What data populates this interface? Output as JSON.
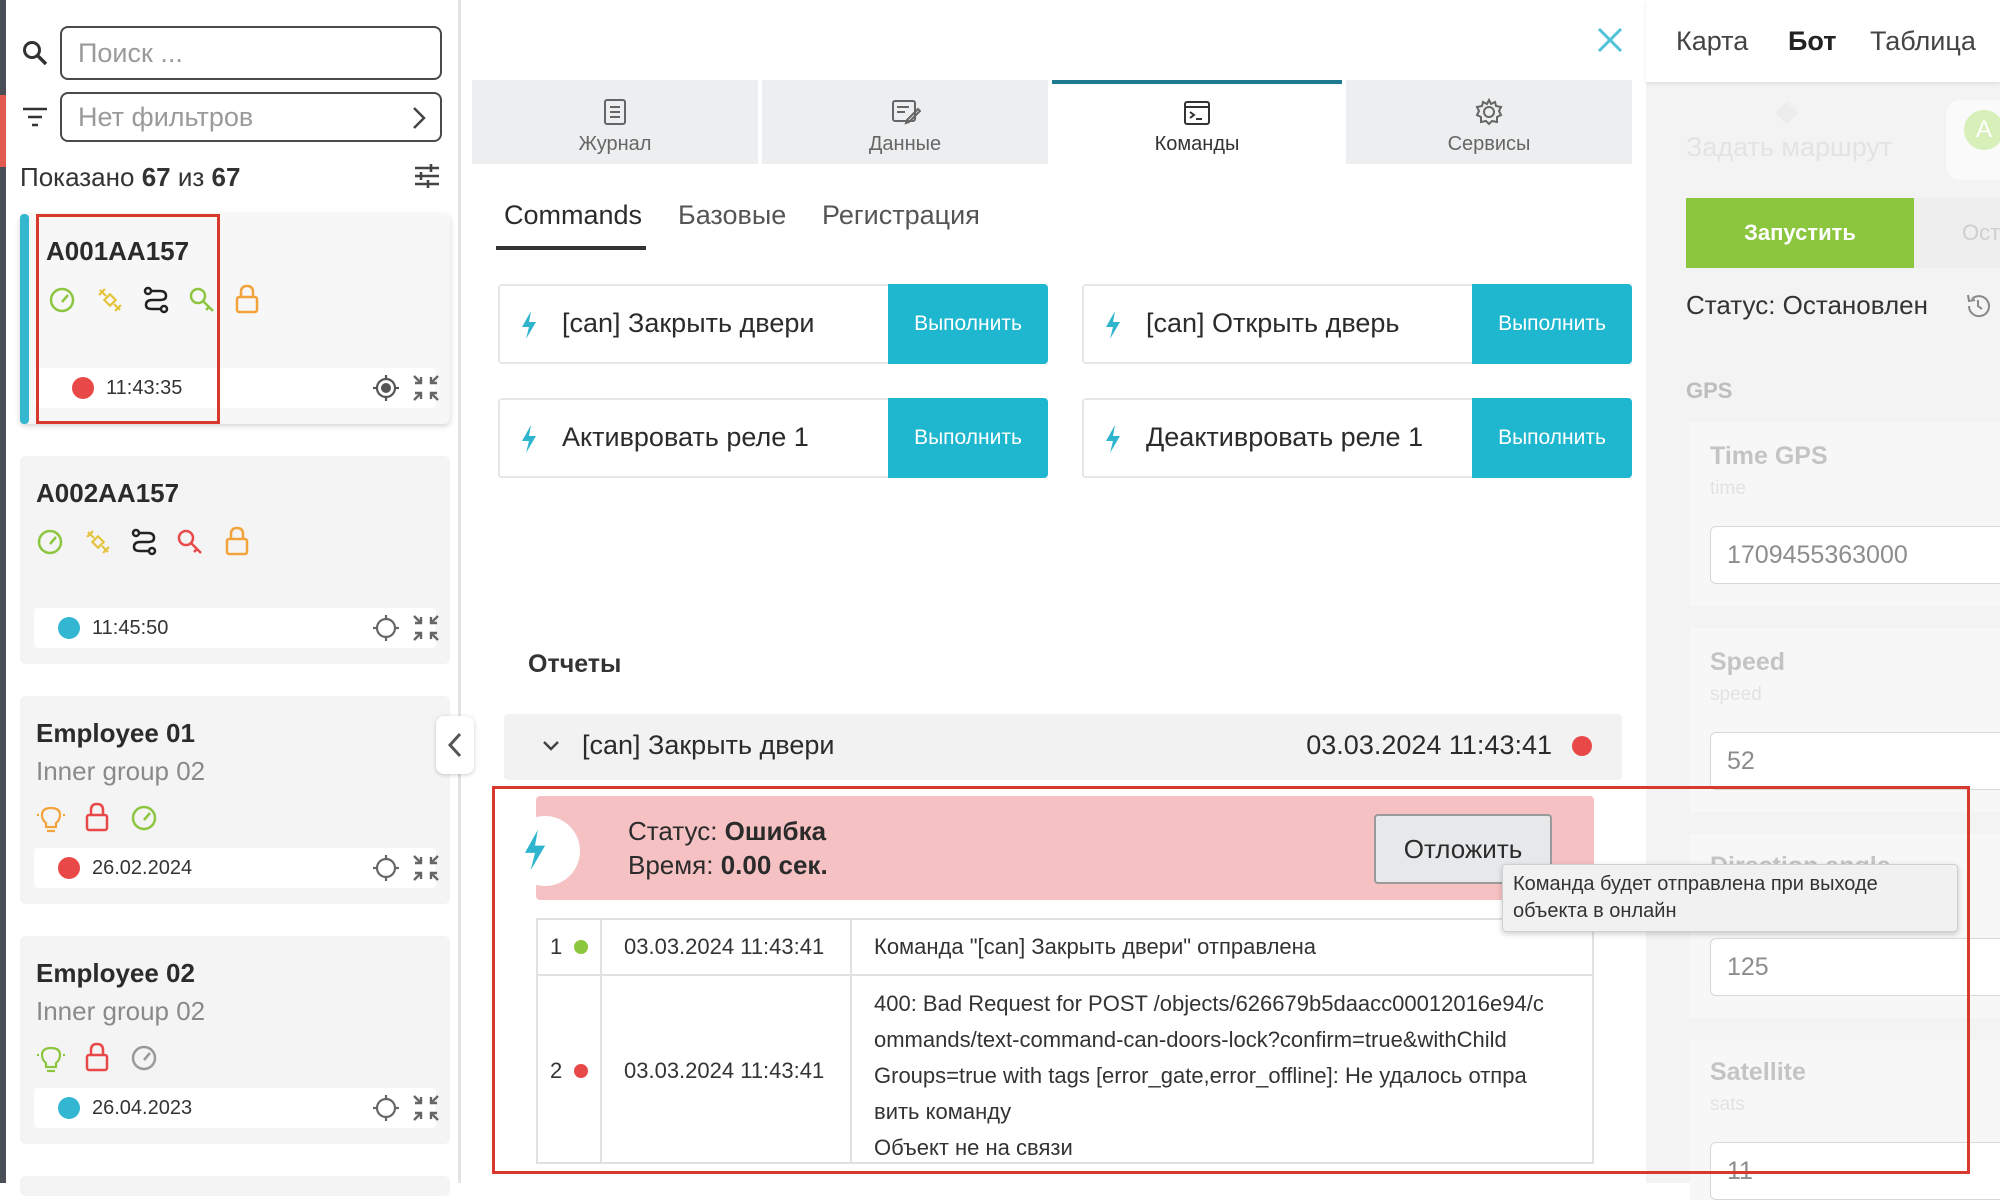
{
  "search": {
    "placeholder": "Поиск ..."
  },
  "filter": {
    "value": "Нет фильтров"
  },
  "shown": {
    "prefix": "Показано",
    "count": "67",
    "sep": "из",
    "total": "67"
  },
  "objects": [
    {
      "title": "A001AA157",
      "subtitle": "",
      "time": "11:43:35",
      "status_color": "#e84848"
    },
    {
      "title": "A002AA157",
      "subtitle": "",
      "time": "11:45:50",
      "status_color": "#33b6d1"
    },
    {
      "title": "Employee 01",
      "subtitle": "Inner group 02",
      "time": "26.02.2024",
      "status_color": "#e84848"
    },
    {
      "title": "Employee 02",
      "subtitle": "Inner group 02",
      "time": "26.04.2023",
      "status_color": "#33b6d1"
    }
  ],
  "main_tabs": [
    {
      "label": "Журнал",
      "icon": "journal-icon"
    },
    {
      "label": "Данные",
      "icon": "data-icon"
    },
    {
      "label": "Команды",
      "icon": "terminal-icon"
    },
    {
      "label": "Сервисы",
      "icon": "gear-icon"
    }
  ],
  "sub_tabs": [
    {
      "label": "Commands"
    },
    {
      "label": "Базовые"
    },
    {
      "label": "Регистрация"
    }
  ],
  "commands": [
    {
      "name": "[can] Закрыть двери",
      "action": "Выполнить"
    },
    {
      "name": "[can] Открыть дверь",
      "action": "Выполнить"
    },
    {
      "name": "Активровать реле 1",
      "action": "Выполнить"
    },
    {
      "name": "Деактивровать реле 1",
      "action": "Выполнить"
    }
  ],
  "reports": {
    "title": "Отчеты",
    "item": {
      "name": "[can] Закрыть двери",
      "datetime": "03.03.2024 11:43:41",
      "status_color": "#e84848"
    },
    "status_label": "Статус:",
    "status_value": "Ошибка",
    "time_label": "Время:",
    "time_value": "0.00 сек.",
    "postpone": "Отложить",
    "tooltip_line1": "Команда будет отправлена при выходе",
    "tooltip_line2": "объекта в онлайн",
    "log": [
      {
        "n": "1",
        "color": "#8cc63f",
        "datetime": "03.03.2024 11:43:41",
        "lines": [
          "Команда \"[can] Закрыть двери\" отправлена"
        ]
      },
      {
        "n": "2",
        "color": "#e84848",
        "datetime": "03.03.2024 11:43:41",
        "lines": [
          "400: Bad Request for POST /objects/626679b5daacc00012016e94/c",
          "ommands/text-command-can-doors-lock?confirm=true&withChild",
          "Groups=true with tags [error_gate,error_offline]: Не удалось отпра",
          "вить команду",
          "Объект не на связи"
        ]
      }
    ]
  },
  "right": {
    "tabs": [
      "Карта",
      "Бот",
      "Таблица"
    ],
    "route": "Задать маршрут",
    "avatar": "A",
    "start": "Запустить",
    "stop": "Ост",
    "status": "Статус: Остановлен",
    "gps": "GPS",
    "fields": [
      {
        "label": "Time GPS",
        "sub": "time",
        "value": "1709455363000"
      },
      {
        "label": "Speed",
        "sub": "speed",
        "value": "52"
      },
      {
        "label": "Direction angle",
        "sub": "",
        "value": "125"
      },
      {
        "label": "Satellite",
        "sub": "sats",
        "value": "11"
      }
    ]
  },
  "colors": {
    "accent": "#1fb7cf",
    "green": "#8cc63f",
    "error_bg": "#f5c1c3",
    "highlight": "#d9382c"
  }
}
